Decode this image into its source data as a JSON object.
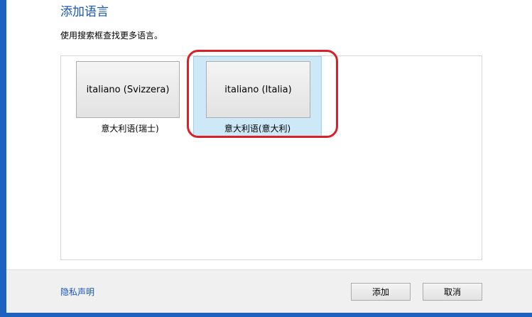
{
  "dialog": {
    "title": "添加语言",
    "instruction": "使用搜索框查找更多语言。"
  },
  "languages": [
    {
      "native_name": "italiano (Svizzera)",
      "localized_name": "意大利语(瑞士)",
      "selected": false
    },
    {
      "native_name": "italiano (Italia)",
      "localized_name": "意大利语(意大利)",
      "selected": true
    }
  ],
  "footer": {
    "privacy_link": "隐私声明",
    "add_button": "添加",
    "cancel_button": "取消"
  },
  "colors": {
    "frame_accent": "#1e62c0",
    "title_text": "#1a56b4",
    "selected_tile": "#cde8f7",
    "highlight_ring": "#d9202a",
    "footer_background": "#f0f0f0"
  }
}
